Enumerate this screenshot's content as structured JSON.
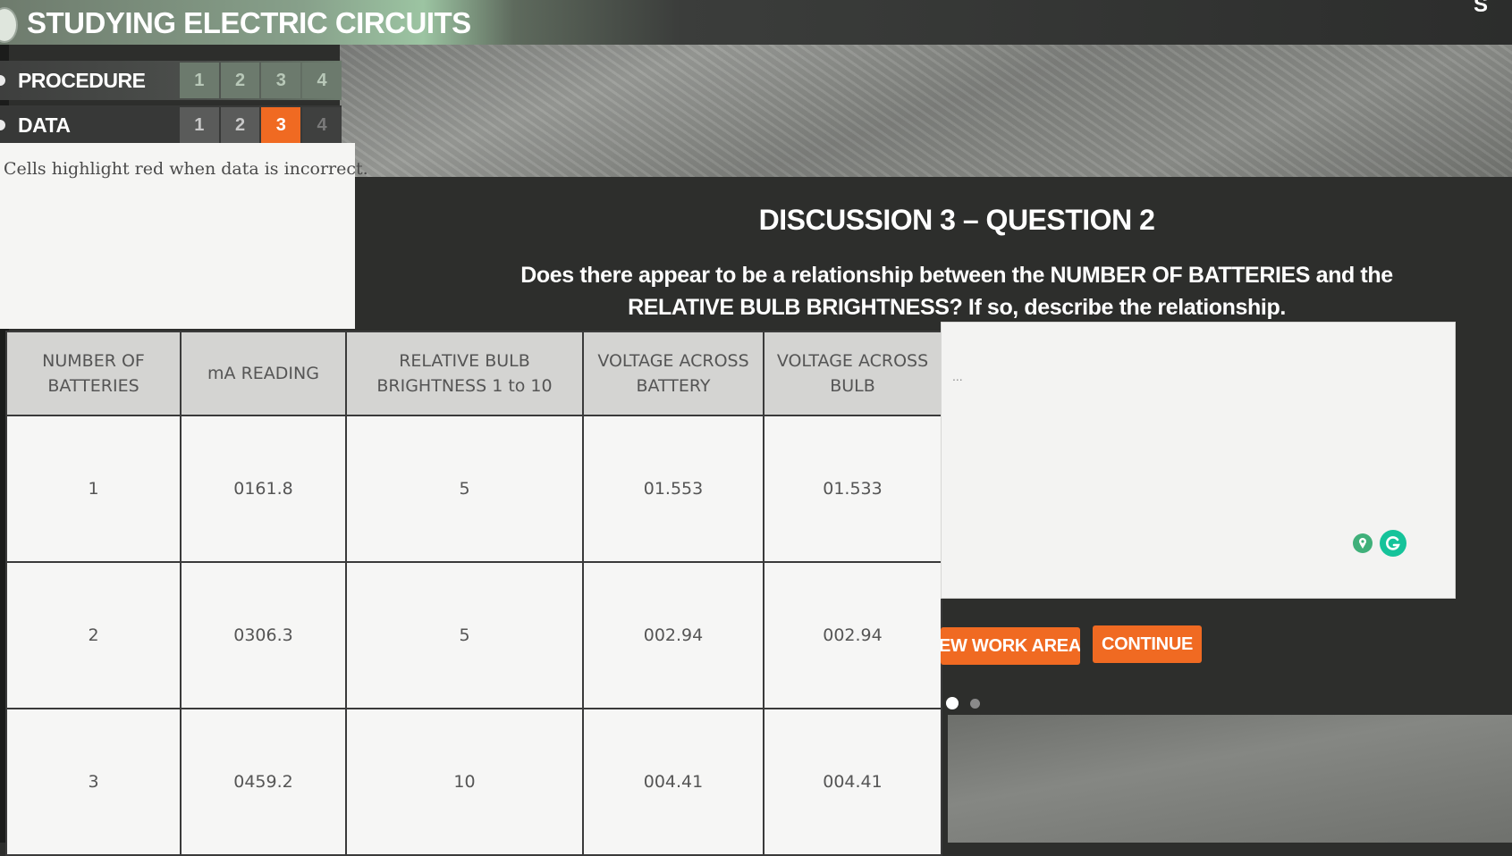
{
  "app": {
    "title": "STUDYING ELECTRIC CIRCUITS",
    "corner_letter": "S"
  },
  "progress": {
    "procedure": {
      "label": "PROCEDURE",
      "steps": [
        "1",
        "2",
        "3",
        "4"
      ],
      "active_step": "3"
    },
    "data": {
      "label": "DATA",
      "steps": [
        "1",
        "2",
        "3",
        "4"
      ],
      "active_step": "3"
    }
  },
  "data_panel": {
    "note": "Cells highlight red when data is incorrect."
  },
  "discussion": {
    "heading": "DISCUSSION 3 – QUESTION 2",
    "question": "Does there appear to be a relationship between the NUMBER OF BATTERIES and the RELATIVE BULB BRIGHTNESS? If so, describe the relationship."
  },
  "table": {
    "headers": [
      "NUMBER OF BATTERIES",
      "mA READING",
      "RELATIVE BULB BRIGHTNESS 1 to 10",
      "VOLTAGE ACROSS BATTERY",
      "VOLTAGE ACROSS BULB"
    ],
    "rows": [
      [
        "1",
        "0161.8",
        "5",
        "01.553",
        "01.533"
      ],
      [
        "2",
        "0306.3",
        "5",
        "002.94",
        "002.94"
      ],
      [
        "3",
        "0459.2",
        "10",
        "004.41",
        "004.41"
      ]
    ]
  },
  "answer": {
    "value": "",
    "ellipsis": "..."
  },
  "buttons": {
    "work_area": "EW WORK AREA",
    "continue": "CONTINUE"
  },
  "colors": {
    "accent": "#f06a22",
    "grammarly": "#15c39a"
  }
}
